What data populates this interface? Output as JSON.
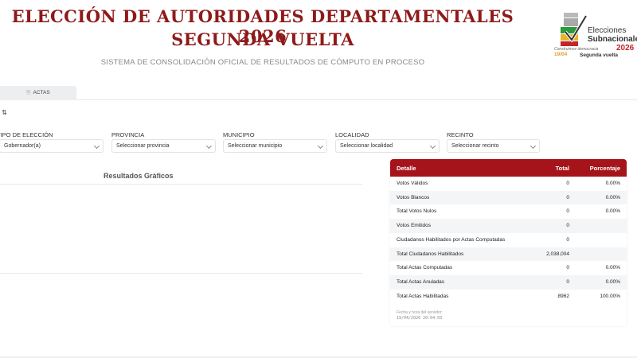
{
  "header": {
    "title_line1": "ELECCIÓN DE AUTORIDADES DEPARTAMENTALES 2026",
    "title_line2": "SEGUNDA VUELTA",
    "subtitle": "SISTEMA DE CONSOLIDACIÓN OFICIAL DE RESULTADOS DE CÓMPUTO EN PROCESO"
  },
  "logo": {
    "line1": "Elecciones",
    "line2": "Subnacionales",
    "year": "2026",
    "tagline": "Construimos democracia",
    "date": "19/04",
    "round": "Segunda vuelta"
  },
  "tabs": [
    {
      "label": "ACTAS",
      "icon": "document-icon"
    }
  ],
  "sort_icon": "⇅",
  "filters": [
    {
      "label": "TIPO DE ELECCIÓN",
      "value": "Gobernador(a)"
    },
    {
      "label": "PROVINCIA",
      "value": "Seleccionar provincia"
    },
    {
      "label": "MUNICIPIO",
      "value": "Seleccionar municipio"
    },
    {
      "label": "LOCALIDAD",
      "value": "Seleccionar localidad"
    },
    {
      "label": "RECINTO",
      "value": "Seleccionar recinto"
    }
  ],
  "results": {
    "title": "Resultados Gráficos"
  },
  "table": {
    "headers": [
      "Detalle",
      "Total",
      "Porcentaje"
    ],
    "rows": [
      {
        "detalle": "Votos Válidos",
        "total": "0",
        "porcentaje": "0.00%"
      },
      {
        "detalle": "Votos Blancos",
        "total": "0",
        "porcentaje": "0.00%"
      },
      {
        "detalle": "Total Votos Nulos",
        "total": "0",
        "porcentaje": "0.00%"
      },
      {
        "detalle": "Votos Emitidos",
        "total": "0",
        "porcentaje": ""
      },
      {
        "detalle": "Ciudadanos Habilitados por Actas Computadas",
        "total": "0",
        "porcentaje": ""
      },
      {
        "detalle": "Total Ciudadanos Habilitados",
        "total": "2,038,004",
        "porcentaje": ""
      },
      {
        "detalle": "Total Actas Computadas",
        "total": "0",
        "porcentaje": "0.00%"
      },
      {
        "detalle": "Total Actas Anuladas",
        "total": "0",
        "porcentaje": "0.00%"
      },
      {
        "detalle": "Total Actas Habilitadas",
        "total": "8962",
        "porcentaje": "100.00%"
      }
    ],
    "footer_label": "Fecha y hora del servidor:",
    "footer_value": "19/04/2026 20:04:03"
  },
  "colors": {
    "accent": "#a5141a",
    "title": "#8e1a1a"
  }
}
